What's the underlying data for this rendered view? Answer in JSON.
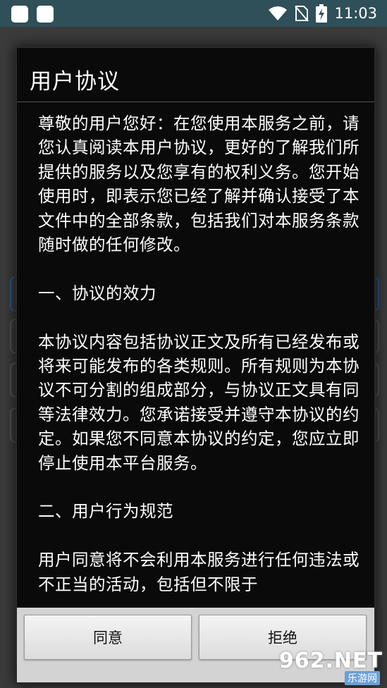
{
  "status_bar": {
    "time": "11:03",
    "icons": [
      "app-icon",
      "app-icon",
      "wifi-icon",
      "no-sim-icon",
      "battery-charging-icon"
    ]
  },
  "dialog": {
    "title": "用户协议",
    "paragraphs": [
      "尊敬的用户您好：在您使用本服务之前，请您认真阅读本用户协议，更好的了解我们所提供的服务以及您享有的权利义务。您开始使用时，即表示您已经了解并确认接受了本文件中的全部条款，包括我们对本服务条款随时做的任何修改。",
      "一、协议的效力",
      "本协议内容包括协议正文及所有已经发布或将来可能发布的各类规则。所有规则为本协议不可分割的组成部分，与协议正文具有同等法律效力。您承诺接受并遵守本协议的约定。如果您不同意本协议的约定，您应立即停止使用本平台服务。",
      "二、用户行为规范",
      "用户同意将不会利用本服务进行任何违法或不正当的活动，包括但不限于"
    ],
    "buttons": {
      "agree": "同意",
      "reject": "拒绝"
    }
  },
  "watermark": {
    "main": "962.NET",
    "sub": "乐游网"
  },
  "colors": {
    "status_bar_bg": "#2f4f59",
    "dialog_bg": "#0a0a0a",
    "button_bar_bg": "#d3d3d3",
    "watermark_accent": "#f29a1f"
  }
}
